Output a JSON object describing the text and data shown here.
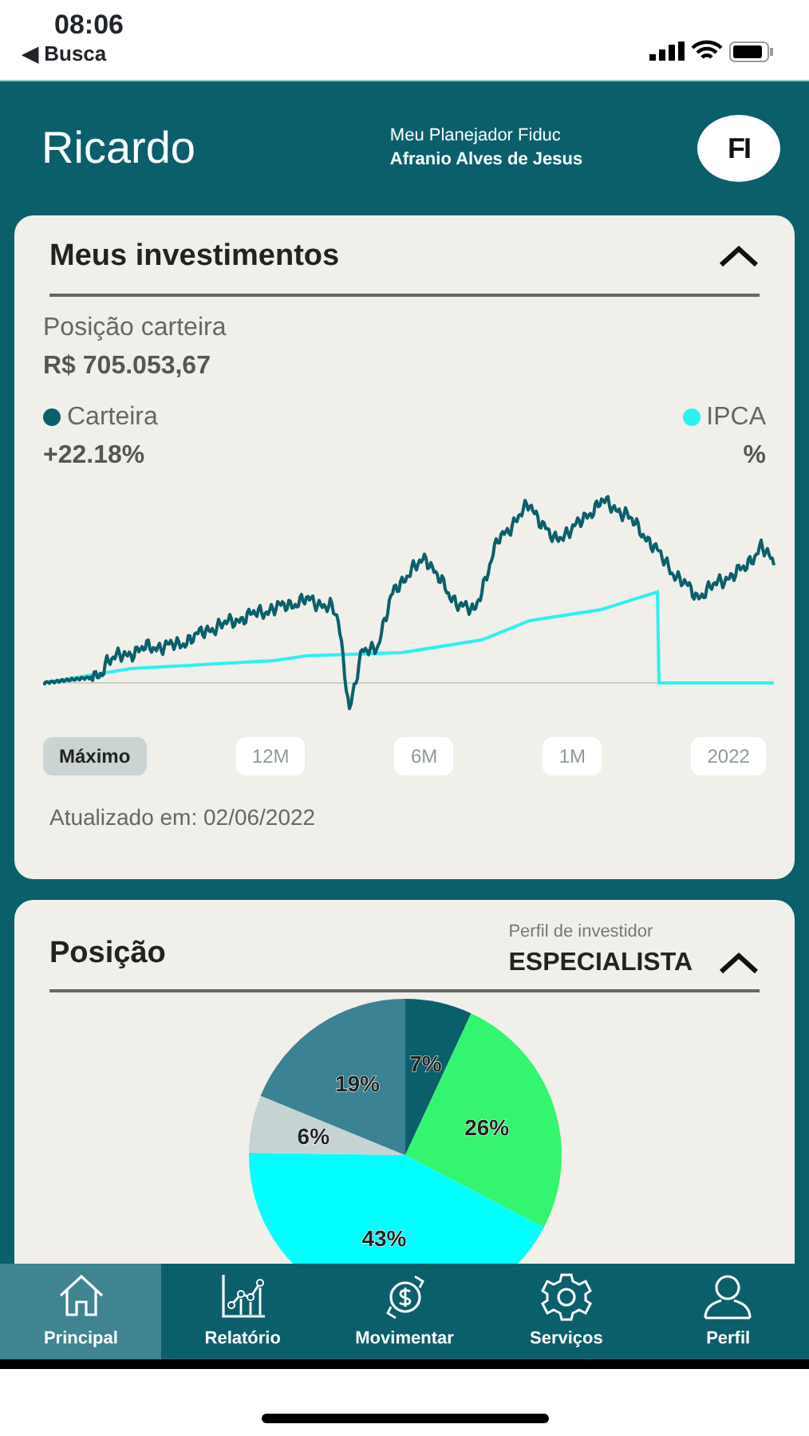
{
  "status_bar": {
    "time": "08:06",
    "back": "◀ Busca"
  },
  "header": {
    "name": "Ricardo",
    "planner_label": "Meu Planejador Fiduc",
    "planner_name": "Afranio Alves de Jesus",
    "logo": "FI"
  },
  "investments": {
    "title": "Meus investimentos",
    "expanded": true,
    "position_label": "Posição carteira",
    "position_value": "R$ 705.053,67",
    "legend": [
      {
        "label": "Carteira",
        "color": "#0b5f6b",
        "value": "+22.18%"
      },
      {
        "label": "IPCA",
        "color": "#2ff0f0",
        "value": "%"
      }
    ],
    "periods": [
      {
        "label": "Máximo",
        "selected": true
      },
      {
        "label": "12M",
        "selected": false
      },
      {
        "label": "6M",
        "selected": false
      },
      {
        "label": "1M",
        "selected": false
      },
      {
        "label": "2022",
        "selected": false
      }
    ],
    "updated": "Atualizado em: 02/06/2022"
  },
  "position": {
    "title": "Posição",
    "profile_label": "Perfil de investidor",
    "profile_value": "ESPECIALISTA",
    "expanded": true,
    "chart_data": {
      "type": "pie",
      "value_labels": [
        "7%",
        "26%",
        "43%",
        "6%",
        "19%"
      ],
      "series": [
        {
          "values": [
            7,
            26,
            43,
            6,
            19
          ],
          "colors": [
            "#0b5f6b",
            "#33f56f",
            "#00ffff",
            "#c5d3d3",
            "#3a8294"
          ]
        }
      ]
    }
  },
  "nav": [
    {
      "label": "Principal",
      "selected": true
    },
    {
      "label": "Relatório",
      "selected": false
    },
    {
      "label": "Movimentar",
      "selected": false
    },
    {
      "label": "Serviços",
      "selected": false
    },
    {
      "label": "Perfil",
      "selected": false
    }
  ]
}
